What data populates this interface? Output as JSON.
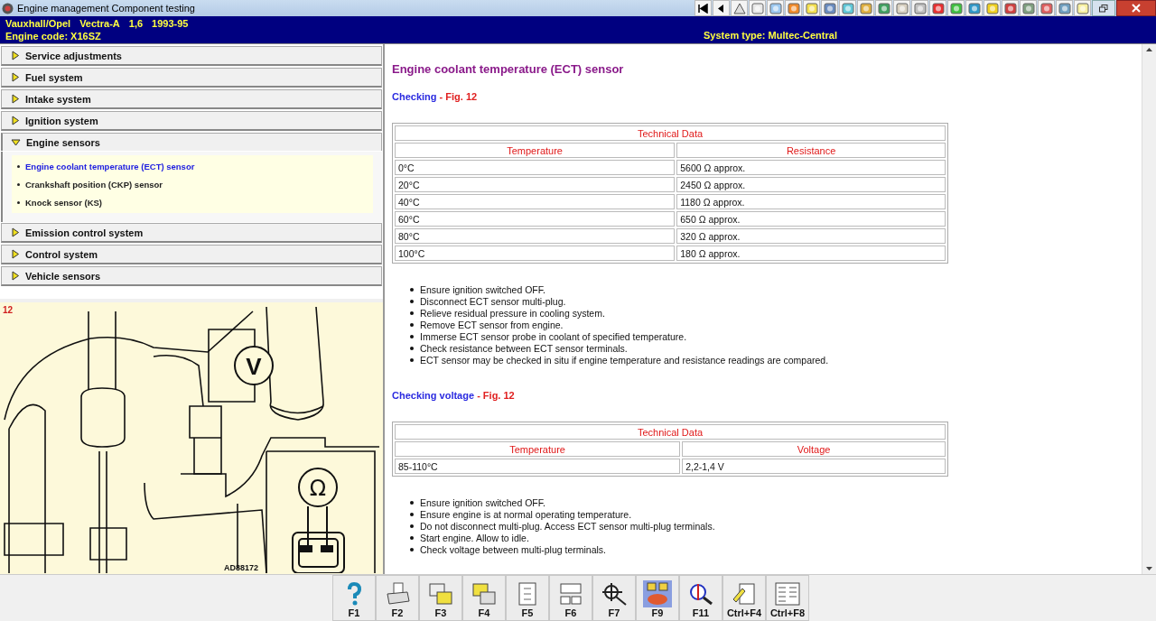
{
  "window": {
    "title": "Engine management Component testing"
  },
  "header": {
    "vehicle": [
      "Vauxhall/Opel",
      "Vectra-A",
      "1,6",
      "1993-95"
    ],
    "engine_code": "Engine code: X16SZ",
    "system_type": "System type: Multec-Central"
  },
  "sidebar": {
    "sections": [
      {
        "label": "Service adjustments",
        "expanded": false
      },
      {
        "label": "Fuel system",
        "expanded": false
      },
      {
        "label": "Intake system",
        "expanded": false
      },
      {
        "label": "Ignition system",
        "expanded": false
      },
      {
        "label": "Engine sensors",
        "expanded": true,
        "children": [
          {
            "label": "Engine coolant temperature (ECT) sensor",
            "selected": true
          },
          {
            "label": "Crankshaft position (CKP) sensor",
            "selected": false
          },
          {
            "label": "Knock sensor (KS)",
            "selected": false
          }
        ]
      },
      {
        "label": "Emission control system",
        "expanded": false
      },
      {
        "label": "Control system",
        "expanded": false
      },
      {
        "label": "Vehicle sensors",
        "expanded": false
      }
    ]
  },
  "figure": {
    "number": "12",
    "reference": "AD88172",
    "meter_labels": [
      "V",
      "Ω"
    ]
  },
  "content": {
    "title": "Engine coolant temperature (ECT) sensor",
    "blocks": [
      {
        "kind": "heading",
        "label": "Checking",
        "figure_ref": "- Fig. 12"
      },
      {
        "kind": "table",
        "title": "Technical Data",
        "columns": [
          "Temperature",
          "Resistance"
        ],
        "rows": [
          [
            "0°C",
            "5600 Ω approx."
          ],
          [
            "20°C",
            "2450 Ω approx."
          ],
          [
            "40°C",
            "1180 Ω approx."
          ],
          [
            "60°C",
            "650 Ω approx."
          ],
          [
            "80°C",
            "320 Ω approx."
          ],
          [
            "100°C",
            "180 Ω approx."
          ]
        ]
      },
      {
        "kind": "bullets",
        "items": [
          "Ensure ignition switched OFF.",
          "Disconnect ECT sensor multi-plug.",
          "Relieve residual pressure in cooling system.",
          "Remove ECT sensor from engine.",
          "Immerse ECT sensor probe in coolant of specified temperature.",
          "Check resistance between ECT sensor terminals.",
          "ECT sensor may be checked in situ if engine temperature and resistance readings are compared."
        ]
      },
      {
        "kind": "heading",
        "label": "Checking voltage",
        "figure_ref": "- Fig. 12"
      },
      {
        "kind": "table",
        "title": "Technical Data",
        "columns": [
          "Temperature",
          "Voltage"
        ],
        "rows": [
          [
            "85-110°C",
            "2,2-1,4 V"
          ]
        ]
      },
      {
        "kind": "bullets",
        "items": [
          "Ensure ignition switched OFF.",
          "Ensure engine is at normal operating temperature.",
          "Do not disconnect multi-plug. Access ECT sensor multi-plug terminals.",
          "Start engine. Allow to idle.",
          "Check voltage between multi-plug terminals."
        ]
      }
    ]
  },
  "function_keys": [
    {
      "label": "F1",
      "kind": "help",
      "selected": false
    },
    {
      "label": "F2",
      "kind": "printer",
      "selected": false
    },
    {
      "label": "F3",
      "kind": "pages",
      "selected": false
    },
    {
      "label": "F4",
      "kind": "pages-alt",
      "selected": false
    },
    {
      "label": "F5",
      "kind": "document",
      "selected": false
    },
    {
      "label": "F6",
      "kind": "diagram",
      "selected": false
    },
    {
      "label": "F7",
      "kind": "magnifier",
      "selected": false
    },
    {
      "label": "F9",
      "kind": "component",
      "selected": true
    },
    {
      "label": "F11",
      "kind": "search",
      "selected": false
    },
    {
      "label": "Ctrl+F4",
      "kind": "notes",
      "selected": false
    },
    {
      "label": "Ctrl+F8",
      "kind": "list",
      "selected": false
    }
  ]
}
